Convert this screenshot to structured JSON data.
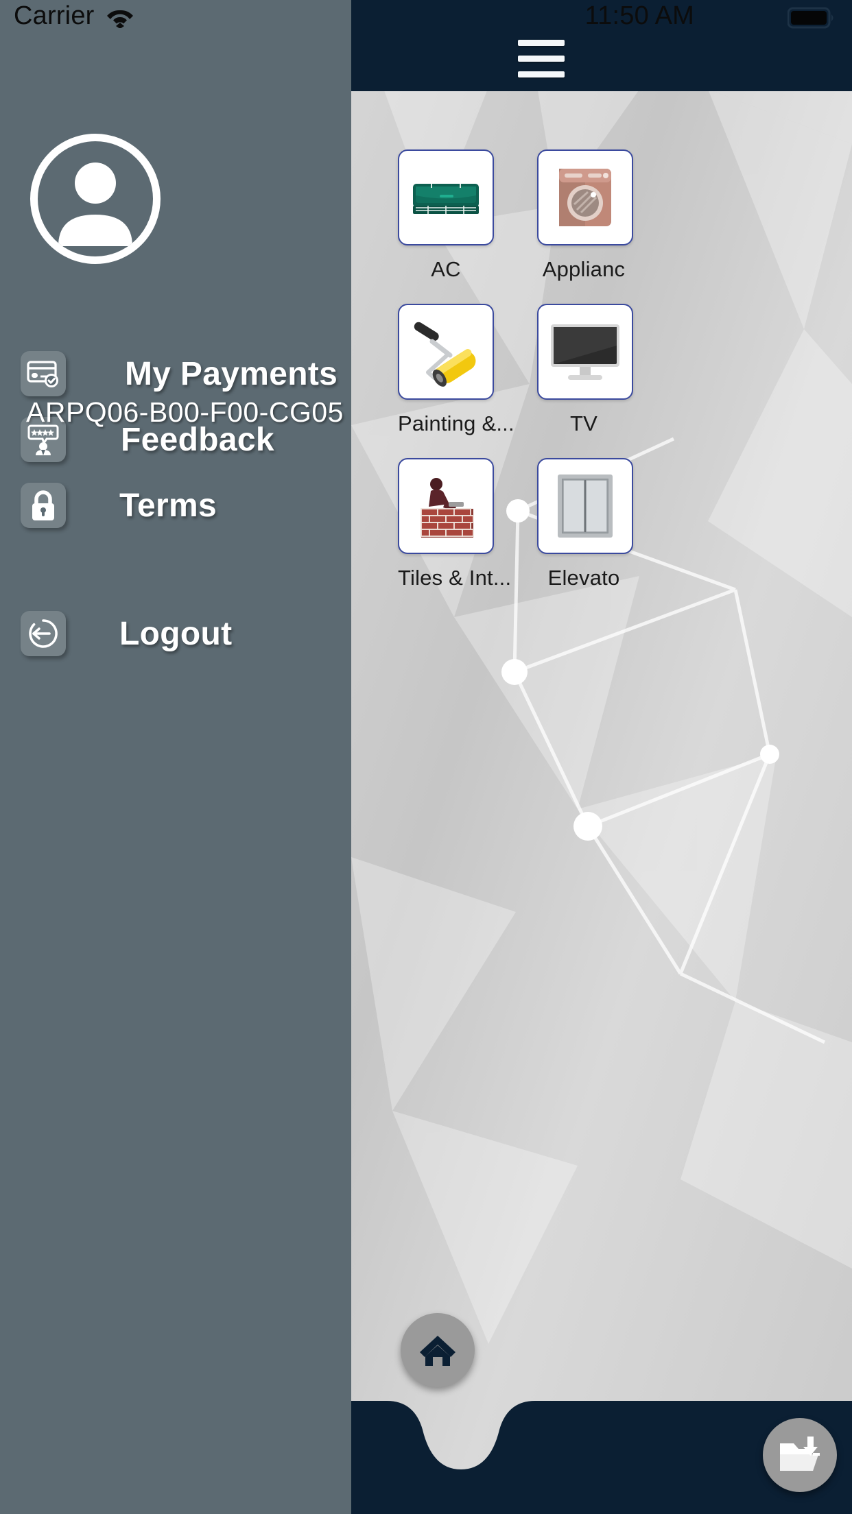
{
  "status_bar": {
    "carrier": "Carrier",
    "wifi_icon": "wifi-icon",
    "time": "11:50 AM",
    "battery_icon": "battery-full-icon"
  },
  "drawer": {
    "avatar_icon": "person-avatar-icon",
    "user_id": "ARPQ06-B00-F00-CG05",
    "background_color": "#5c6a72",
    "items": [
      {
        "label": "My Payments",
        "icon": "credit-card-check-icon"
      },
      {
        "label": "Feedback",
        "icon": "person-rating-bubble-icon"
      },
      {
        "label": "Terms",
        "icon": "lock-icon"
      },
      {
        "label": "Logout",
        "icon": "logout-arrow-circle-icon"
      }
    ]
  },
  "app": {
    "header": {
      "menu_icon": "hamburger-menu-icon",
      "background_color": "#0b1f33"
    },
    "tiles": [
      {
        "label": "AC",
        "icon": "air-conditioner-icon"
      },
      {
        "label": "Applianc",
        "icon": "washing-machine-icon"
      },
      {
        "label": "Painting &...",
        "icon": "paint-roller-icon"
      },
      {
        "label": "TV",
        "icon": "television-icon"
      },
      {
        "label": "Tiles & Int...",
        "icon": "bricklayer-icon"
      },
      {
        "label": "Elevato",
        "icon": "elevator-icon"
      }
    ],
    "bottom_nav": {
      "home_icon": "home-icon",
      "download_icon": "folder-download-icon",
      "background_color": "#0b1f33"
    },
    "tile_border_color": "#3b4a9e"
  }
}
